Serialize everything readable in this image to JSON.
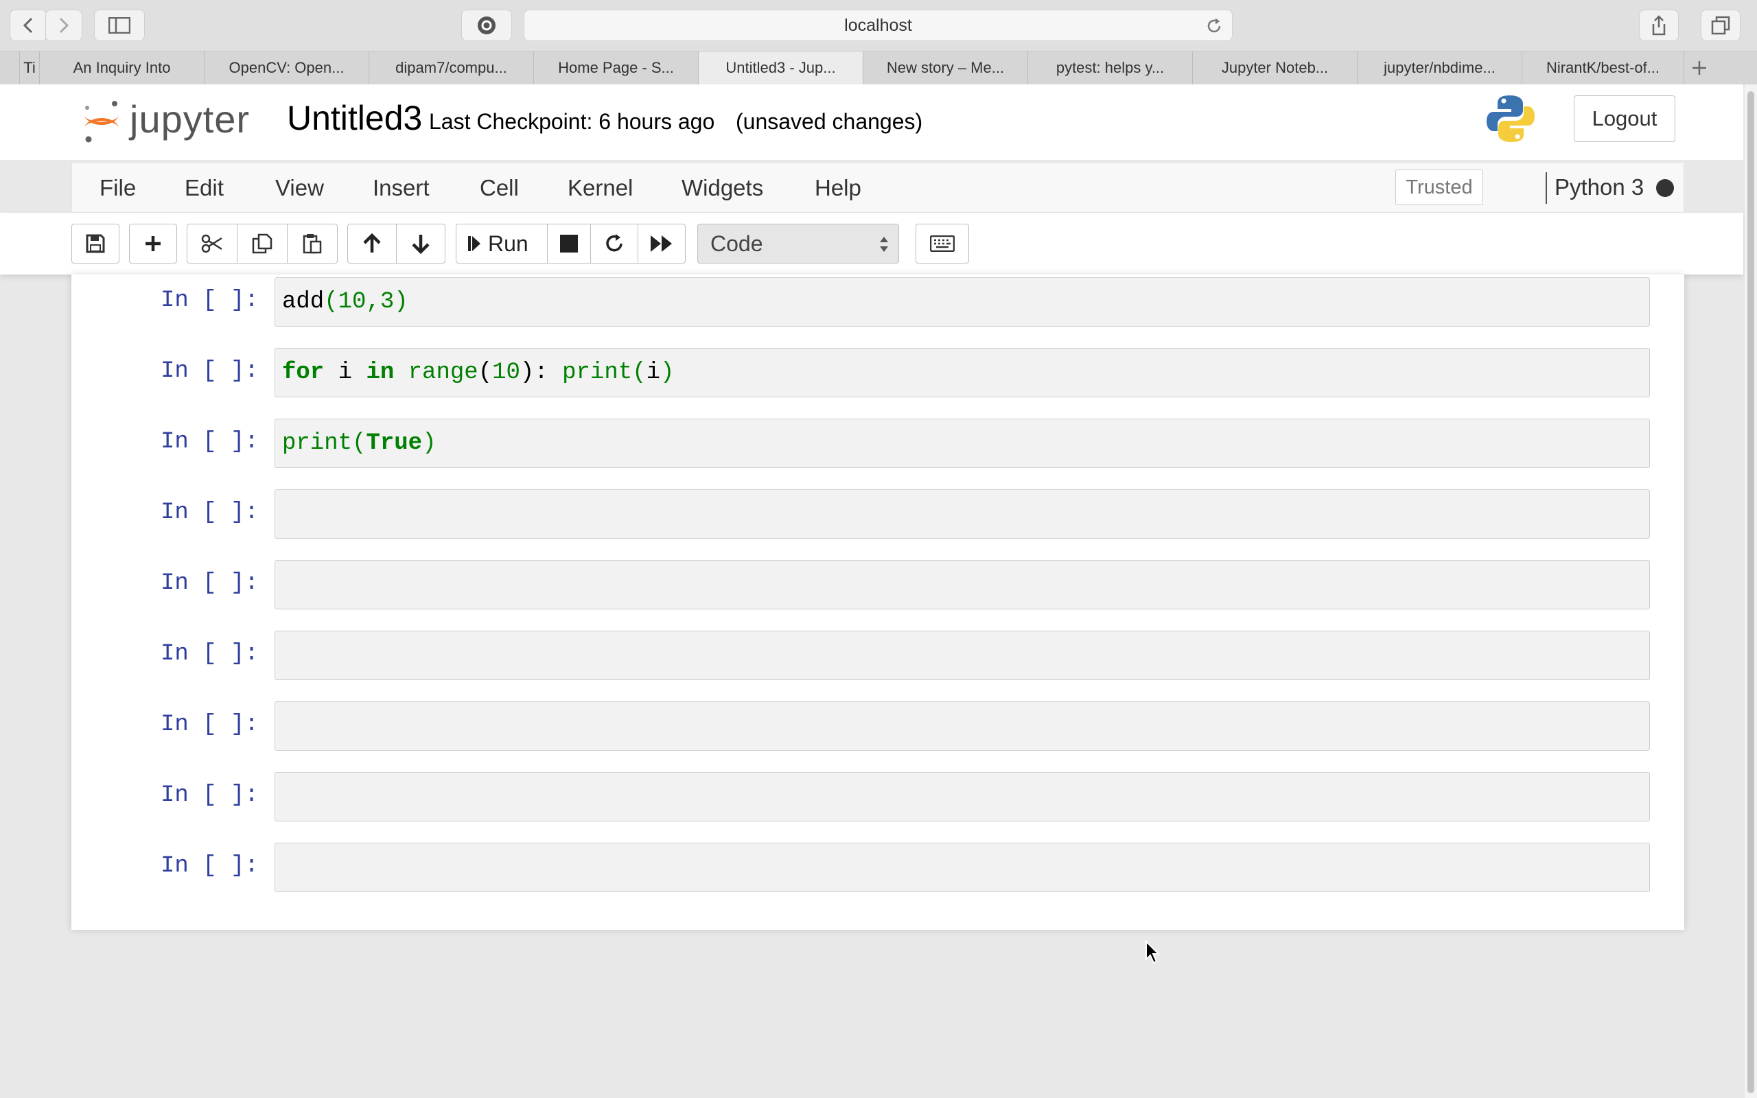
{
  "browser": {
    "url": "localhost",
    "tabs": [
      "Ti",
      "An Inquiry Into",
      "OpenCV: Open...",
      "dipam7/compu...",
      "Home Page - S...",
      "Untitled3 - Jup...",
      "New story – Me...",
      "pytest: helps y...",
      "Jupyter Noteb...",
      "jupyter/nbdime...",
      "NirantK/best-of..."
    ],
    "active_tab": 5
  },
  "header": {
    "logo_text": "jupyter",
    "notebook_name": "Untitled3",
    "checkpoint": "Last Checkpoint: 6 hours ago",
    "unsaved": "(unsaved changes)",
    "logout_label": "Logout"
  },
  "menubar": {
    "items": [
      "File",
      "Edit",
      "View",
      "Insert",
      "Cell",
      "Kernel",
      "Widgets",
      "Help"
    ],
    "trusted_label": "Trusted",
    "kernel_name": "Python 3"
  },
  "toolbar": {
    "run_label": "Run",
    "cell_type": "Code"
  },
  "cells": [
    {
      "prompt": "In [ ]:"
    },
    {
      "prompt": "In [ ]:"
    },
    {
      "prompt": "In [ ]:"
    },
    {
      "prompt": "In [ ]:"
    },
    {
      "prompt": "In [ ]:"
    },
    {
      "prompt": "In [ ]:"
    },
    {
      "prompt": "In [ ]:"
    },
    {
      "prompt": "In [ ]:"
    },
    {
      "prompt": "In [ ]:"
    }
  ],
  "code": {
    "c0": {
      "fn": "add",
      "open": "(",
      "a": "10",
      "comma": ",",
      "b": "3",
      "close": ")"
    },
    "c1": {
      "kw_for": "for",
      "var": " i ",
      "kw_in": "in",
      "sp": " ",
      "range": "range",
      "open": "(",
      "n": "10",
      "close": ")",
      "colon": ": ",
      "print": "print",
      "open2": "(",
      "arg": "i",
      "close2": ")"
    },
    "c2": {
      "print": "print",
      "open": "(",
      "kw_true": "True",
      "close": ")"
    }
  },
  "colors": {
    "accent": "#f37726",
    "prompt": "#303f9f",
    "keyword": "#008000"
  }
}
